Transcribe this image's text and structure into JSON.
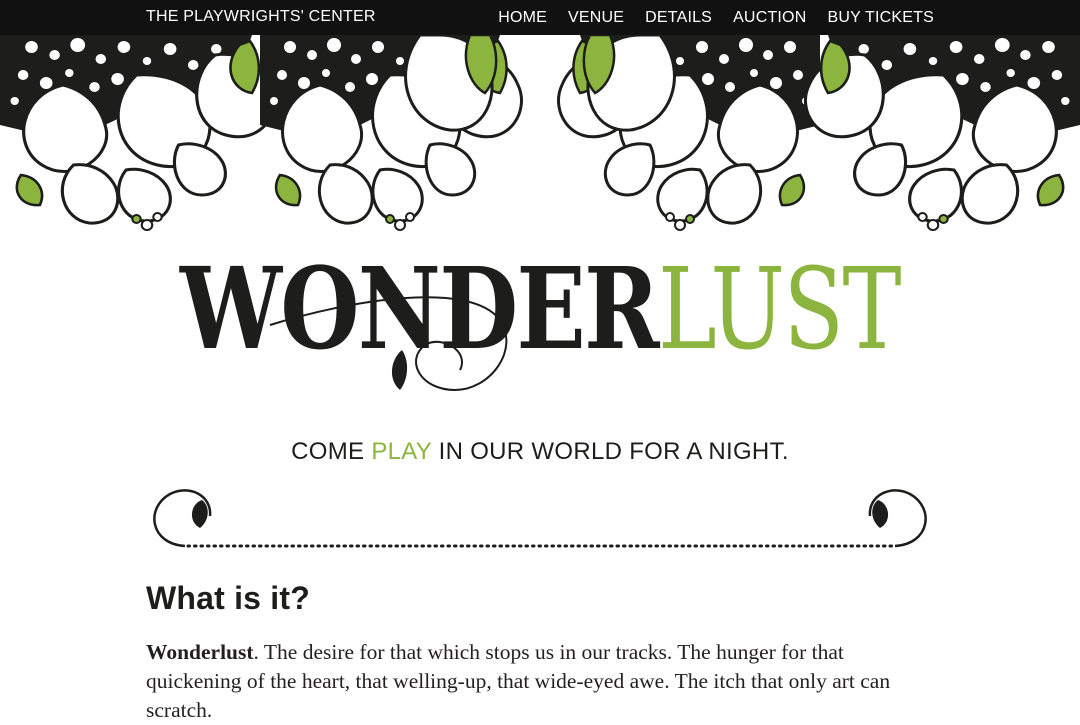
{
  "nav": {
    "brand": "THE PLAYWRIGHTS' CENTER",
    "links": [
      "HOME",
      "VENUE",
      "DETAILS",
      "AUCTION",
      "BUY TICKETS"
    ]
  },
  "hero": {
    "logo_text": "WONDERLUST",
    "logo_dark_part": "WONDER",
    "logo_green_part": "LUST",
    "tagline_before": "COME ",
    "tagline_accent": "PLAY",
    "tagline_after": " IN OUR WORLD FOR A NIGHT."
  },
  "content": {
    "heading": "What is it?",
    "paragraph_lead": "Wonderlust",
    "paragraph_text": ". The desire for that which stops us in our tracks. The hunger for that quickening of the heart, that welling-up, that wide-eyed awe. The itch that only art can scratch."
  },
  "colors": {
    "nav_background": "#111111",
    "accent_green": "#8cb53f",
    "ink": "#231f20"
  },
  "icons": {
    "floral": "floral-border-illustration",
    "divider": "ornamental-swirl-divider"
  }
}
